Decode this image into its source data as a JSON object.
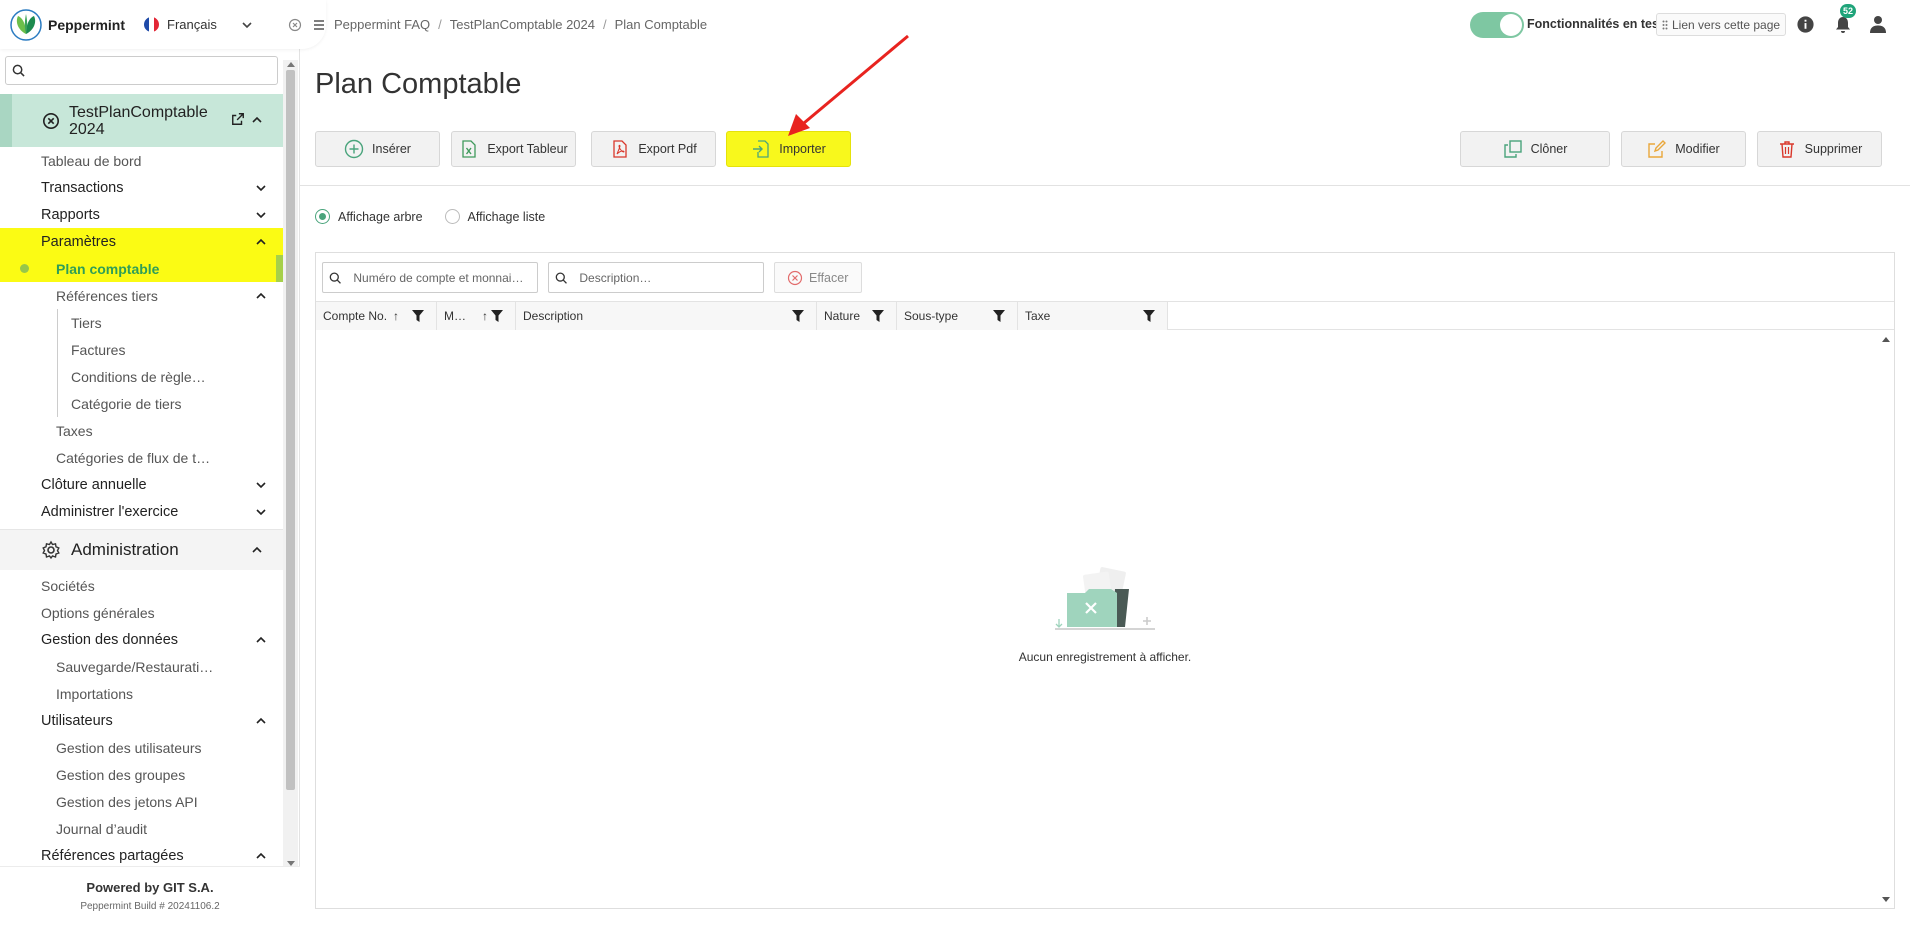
{
  "brand": {
    "name": "Peppermint",
    "language": "Français"
  },
  "sidebar": {
    "search_placeholder": "",
    "context": {
      "title": "TestPlanComptable 2024"
    },
    "items": [
      {
        "label": "Tableau de bord"
      },
      {
        "label": "Transactions"
      },
      {
        "label": "Rapports"
      },
      {
        "label": "Paramètres"
      },
      {
        "label": "Plan comptable"
      },
      {
        "label": "Références tiers"
      },
      {
        "label": "Tiers"
      },
      {
        "label": "Factures"
      },
      {
        "label": "Conditions de règle…"
      },
      {
        "label": "Catégorie de tiers"
      },
      {
        "label": "Taxes"
      },
      {
        "label": "Catégories de flux de t…"
      },
      {
        "label": "Clôture annuelle"
      },
      {
        "label": "Administrer l'exercice"
      }
    ],
    "admin": {
      "title": "Administration",
      "items": [
        {
          "label": "Sociétés"
        },
        {
          "label": "Options générales"
        },
        {
          "label": "Gestion des données"
        },
        {
          "label": "Sauvegarde/Restaurati…"
        },
        {
          "label": "Importations"
        },
        {
          "label": "Utilisateurs"
        },
        {
          "label": "Gestion des utilisateurs"
        },
        {
          "label": "Gestion des groupes"
        },
        {
          "label": "Gestion des jetons API"
        },
        {
          "label": "Journal d’audit"
        },
        {
          "label": "Références partagées"
        }
      ]
    },
    "footer": {
      "powered": "Powered by GIT S.A.",
      "build": "Peppermint Build # 20241106.2"
    }
  },
  "breadcrumb": [
    "Peppermint FAQ",
    "TestPlanComptable 2024",
    "Plan Comptable"
  ],
  "topbar": {
    "toggle_label": "Fonctionnalités en test",
    "toggle_on": true,
    "link_label": "Lien vers cette page",
    "notification_count": "52"
  },
  "page": {
    "title": "Plan Comptable",
    "toolbar": {
      "insert": "Insérer",
      "export_sheet": "Export Tableur",
      "export_pdf": "Export Pdf",
      "import": "Importer",
      "clone": "Clôner",
      "edit": "Modifier",
      "delete": "Supprimer"
    },
    "view_modes": {
      "tree": "Affichage arbre",
      "list": "Affichage liste",
      "selected": "tree"
    },
    "filters": {
      "account_placeholder": "Numéro de compte et monnai…",
      "description_placeholder": "Description…",
      "clear": "Effacer"
    },
    "columns": [
      "Compte No.",
      "M…",
      "Description",
      "Nature",
      "Sous-type",
      "Taxe"
    ],
    "empty_message": "Aucun enregistrement à afficher."
  },
  "colors": {
    "accent": "#4aa47c",
    "highlight": "#fbfb14",
    "annotation_arrow": "#e8231f"
  }
}
